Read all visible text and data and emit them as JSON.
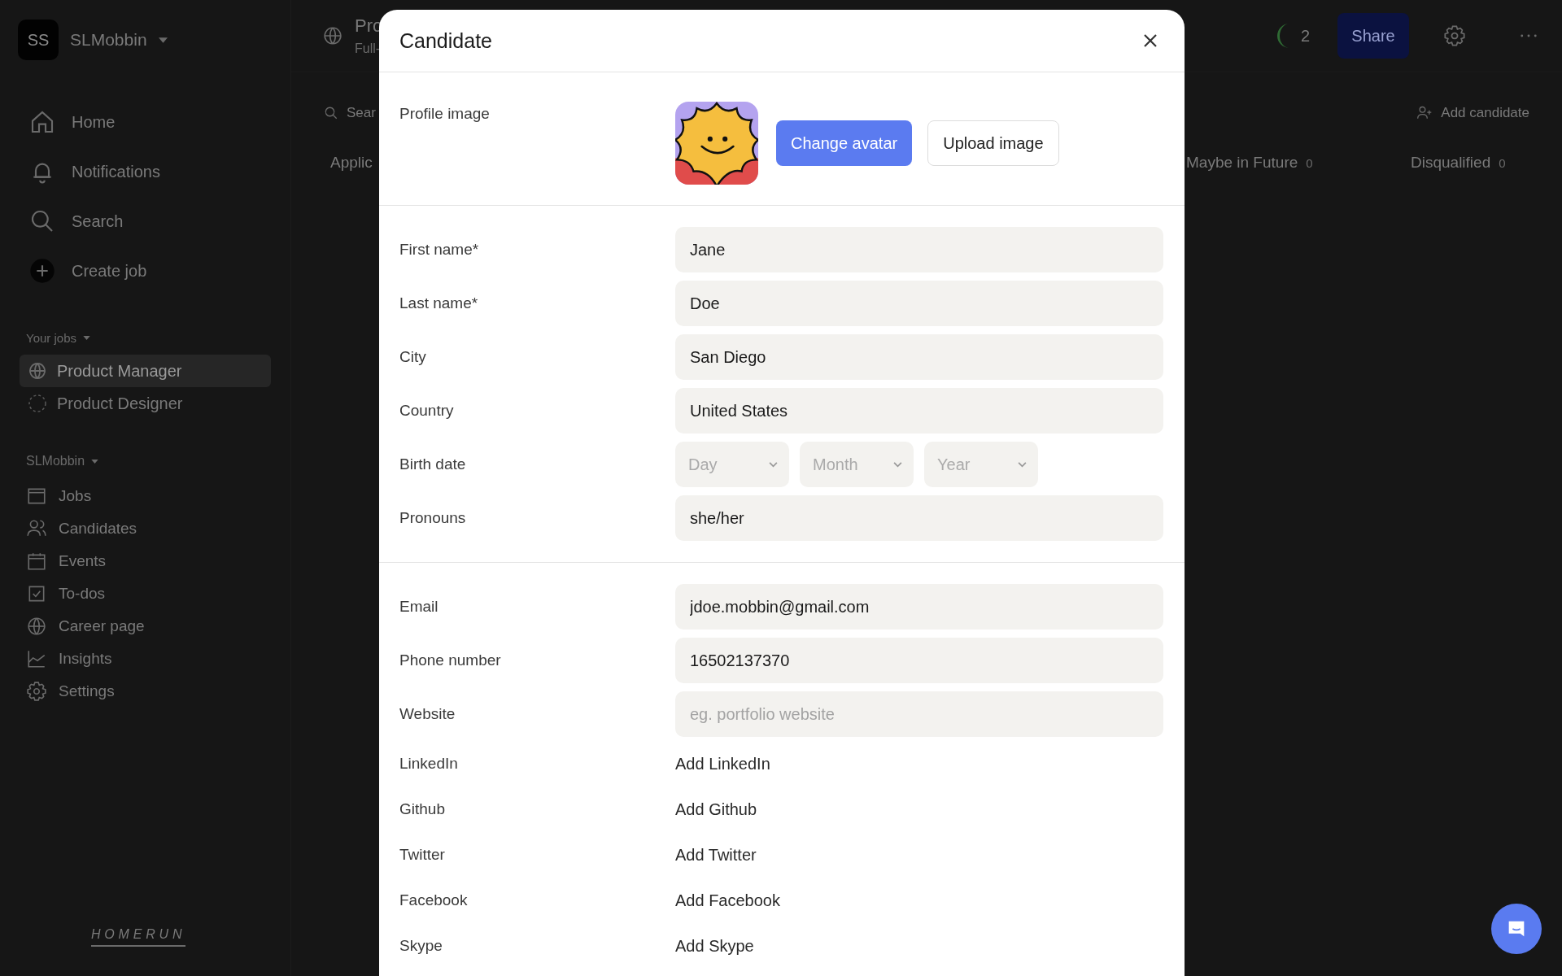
{
  "sidebar": {
    "org": {
      "initials": "SS",
      "name": "SLMobbin"
    },
    "nav": [
      {
        "label": "Home"
      },
      {
        "label": "Notifications"
      },
      {
        "label": "Search"
      },
      {
        "label": "Create job"
      }
    ],
    "jobs_section": {
      "title": "Your jobs",
      "jobs": [
        {
          "title": "Product Manager",
          "selected": true,
          "published": true
        },
        {
          "title": "Product Designer",
          "selected": false,
          "published": false
        }
      ]
    },
    "workspace": {
      "title": "SLMobbin",
      "items": [
        {
          "label": "Jobs"
        },
        {
          "label": "Candidates"
        },
        {
          "label": "Events"
        },
        {
          "label": "To-dos"
        },
        {
          "label": "Career page"
        },
        {
          "label": "Insights"
        },
        {
          "label": "Settings"
        }
      ]
    },
    "logo": "HOMERUN"
  },
  "header": {
    "job_title": "Pro",
    "job_subtitle": "Full-",
    "collaborators_count": "2",
    "share_button": "Share"
  },
  "toolbar": {
    "search": "Sear",
    "add_candidate": "Add candidate"
  },
  "stages": [
    {
      "name": "Applic"
    },
    {
      "name": "Maybe in Future",
      "count": "0"
    },
    {
      "name": "Disqualified",
      "count": "0"
    }
  ],
  "modal": {
    "title": "Candidate",
    "profile_image": {
      "label": "Profile image",
      "change_button": "Change avatar",
      "upload_button": "Upload image"
    },
    "sections": [
      [
        {
          "label": "First name*",
          "kind": "text",
          "value": "Jane"
        },
        {
          "label": "Last name*",
          "kind": "text",
          "value": "Doe"
        },
        {
          "label": "City",
          "kind": "text",
          "value": "San Diego"
        },
        {
          "label": "Country",
          "kind": "text",
          "value": "United States"
        },
        {
          "label": "Birth date",
          "kind": "date",
          "selects": [
            "Day",
            "Month",
            "Year"
          ]
        },
        {
          "label": "Pronouns",
          "kind": "text",
          "value": "she/her"
        }
      ],
      [
        {
          "label": "Email",
          "kind": "text",
          "value": "jdoe.mobbin@gmail.com"
        },
        {
          "label": "Phone number",
          "kind": "text",
          "value": "16502137370"
        },
        {
          "label": "Website",
          "kind": "text",
          "placeholder": "eg. portfolio website"
        },
        {
          "label": "LinkedIn",
          "kind": "link",
          "action": "Add LinkedIn"
        },
        {
          "label": "Github",
          "kind": "link",
          "action": "Add Github"
        },
        {
          "label": "Twitter",
          "kind": "link",
          "action": "Add Twitter"
        },
        {
          "label": "Facebook",
          "kind": "link",
          "action": "Add Facebook"
        },
        {
          "label": "Skype",
          "kind": "link",
          "action": "Add Skype"
        }
      ]
    ]
  }
}
